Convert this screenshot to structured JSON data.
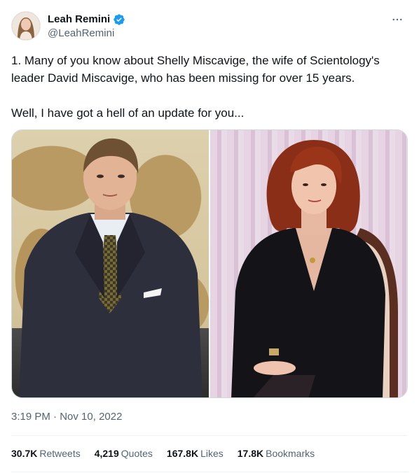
{
  "author": {
    "display_name": "Leah Remini",
    "handle": "@LeahRemini",
    "avatar_icon": "avatar-photo",
    "verified_icon": "verified-badge-icon",
    "verified_color": "#1d9bf0"
  },
  "more_icon": "more-horizontal-icon",
  "tweet": {
    "text": "1. Many of you know about Shelly Miscavige, the wife of Scientology's leader David Miscavige, who has been missing for over 15 years.\n\nWell, I have got a hell of an update for you...",
    "media": [
      {
        "description": "photo-man-in-suit"
      },
      {
        "description": "photo-woman-in-black-dress"
      }
    ]
  },
  "meta": {
    "time": "3:19 PM",
    "separator": "·",
    "date": "Nov 10, 2022"
  },
  "stats": [
    {
      "count": "30.7K",
      "label": "Retweets"
    },
    {
      "count": "4,219",
      "label": "Quotes"
    },
    {
      "count": "167.8K",
      "label": "Likes"
    },
    {
      "count": "17.8K",
      "label": "Bookmarks"
    }
  ],
  "colors": {
    "text_primary": "#0f1419",
    "text_secondary": "#536471",
    "border": "#cfd9de"
  }
}
